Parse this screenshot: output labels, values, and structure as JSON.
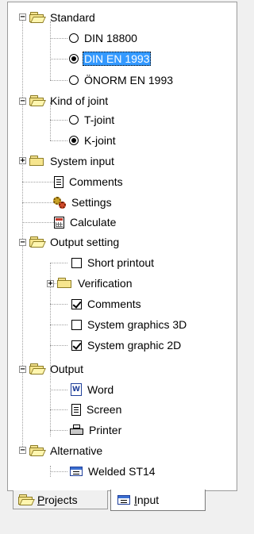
{
  "tree": {
    "standard": {
      "label": "Standard",
      "options": [
        "DIN 18800",
        "DIN EN 1993",
        "ÖNORM EN 1993"
      ],
      "selected": "DIN EN 1993"
    },
    "kind_of_joint": {
      "label": "Kind of joint",
      "options": [
        "T-joint",
        "K-joint"
      ],
      "selected": "K-joint"
    },
    "system_input": {
      "label": "System input"
    },
    "comments": {
      "label": "Comments"
    },
    "settings": {
      "label": "Settings"
    },
    "calculate": {
      "label": "Calculate"
    },
    "output_setting": {
      "label": "Output setting",
      "short_printout": {
        "label": "Short printout",
        "checked": false
      },
      "verification": {
        "label": "Verification"
      },
      "comments": {
        "label": "Comments",
        "checked": true
      },
      "system_graphics_3d": {
        "label": "System graphics 3D",
        "checked": false
      },
      "system_graphic_2d": {
        "label": "System graphic 2D",
        "checked": true
      }
    },
    "output": {
      "label": "Output",
      "word": "Word",
      "screen": "Screen",
      "printer": "Printer"
    },
    "alternative": {
      "label": "Alternative",
      "welded": "Welded ST14"
    }
  },
  "tabs": {
    "projects_first": "P",
    "projects_rest": "rojects",
    "input_first": "I",
    "input_rest": "nput",
    "active": "Input"
  }
}
